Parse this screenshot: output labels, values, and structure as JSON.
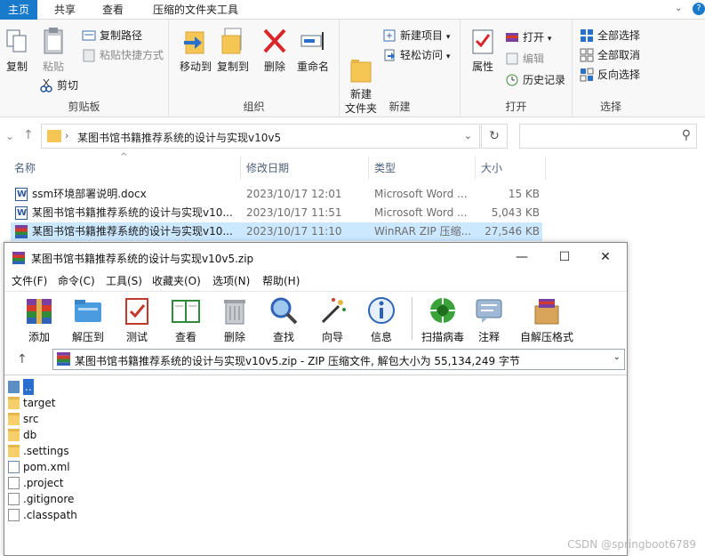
{
  "ribbon_tabs": [
    "主页",
    "共享",
    "查看",
    "压缩的文件夹工具"
  ],
  "ribbon": {
    "clipboard": {
      "copy": "复制",
      "paste": "粘贴",
      "copy_path": "复制路径",
      "paste_shortcut": "粘贴快捷方式",
      "cut": "剪切",
      "label": "剪贴板"
    },
    "organize": {
      "move_to": "移动到",
      "copy_to": "复制到",
      "delete": "删除",
      "rename": "重命名",
      "label": "组织"
    },
    "new": {
      "new_folder": "新建\n文件夹",
      "new_item": "新建项目",
      "easy_access": "轻松访问",
      "label": "新建"
    },
    "open": {
      "properties": "属性",
      "open": "打开",
      "edit": "编辑",
      "history": "历史记录",
      "label": "打开"
    },
    "select": {
      "select_all": "全部选择",
      "select_none": "全部取消",
      "invert": "反向选择",
      "label": "选择"
    }
  },
  "address": {
    "path": "某图书馆书籍推荐系统的设计与实现v10v5",
    "search_placeholder": ""
  },
  "columns": {
    "name": "名称",
    "date": "修改日期",
    "type": "类型",
    "size": "大小"
  },
  "files": [
    {
      "name": "ssm环境部署说明.docx",
      "date": "2023/10/17 12:01",
      "type": "Microsoft Word ...",
      "size": "15 KB",
      "icon": "word-icon",
      "selected": false
    },
    {
      "name": "某图书馆书籍推荐系统的设计与实现v10...",
      "date": "2023/10/17 11:51",
      "type": "Microsoft Word ...",
      "size": "5,043 KB",
      "icon": "word-icon",
      "selected": false
    },
    {
      "name": "某图书馆书籍推荐系统的设计与实现v10...",
      "date": "2023/10/17 11:10",
      "type": "WinRAR ZIP 压缩...",
      "size": "27,546 KB",
      "icon": "rar-icon",
      "selected": true
    }
  ],
  "winrar": {
    "title": "某图书馆书籍推荐系统的设计与实现v10v5.zip",
    "menu": [
      "文件(F)",
      "命令(C)",
      "工具(S)",
      "收藏夹(O)",
      "选项(N)",
      "帮助(H)"
    ],
    "toolbar": [
      "添加",
      "解压到",
      "测试",
      "查看",
      "删除",
      "查找",
      "向导",
      "信息",
      "扫描病毒",
      "注释",
      "自解压格式"
    ],
    "path_text": "某图书馆书籍推荐系统的设计与实现v10v5.zip - ZIP 压缩文件, 解包大小为 55,134,249 字节",
    "items": [
      {
        "name": "..",
        "kind": "updir"
      },
      {
        "name": "target",
        "kind": "folder"
      },
      {
        "name": "src",
        "kind": "folder"
      },
      {
        "name": "db",
        "kind": "folder"
      },
      {
        "name": ".settings",
        "kind": "folder"
      },
      {
        "name": "pom.xml",
        "kind": "xml"
      },
      {
        "name": ".project",
        "kind": "file"
      },
      {
        "name": ".gitignore",
        "kind": "file"
      },
      {
        "name": ".classpath",
        "kind": "file"
      }
    ]
  },
  "watermark": "CSDN @springboot6789"
}
